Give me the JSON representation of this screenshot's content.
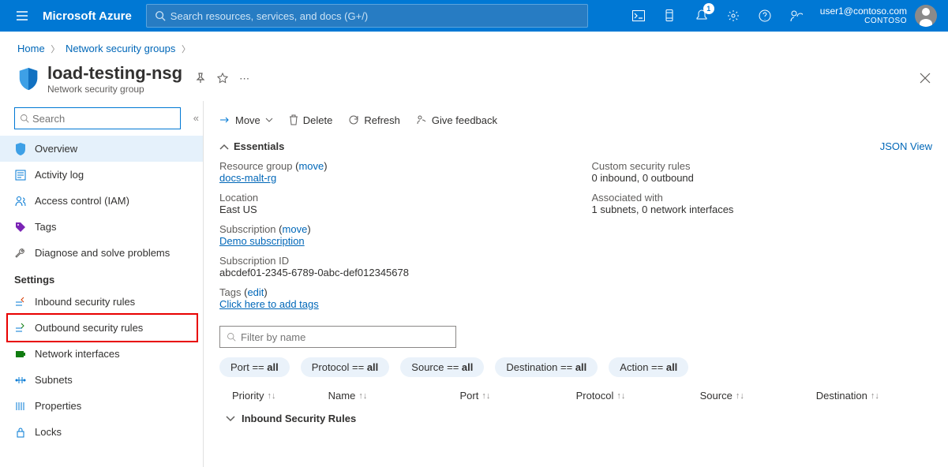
{
  "topbar": {
    "brand": "Microsoft Azure",
    "search_placeholder": "Search resources, services, and docs (G+/)",
    "notification_count": "1",
    "account_email": "user1@contoso.com",
    "account_org": "CONTOSO"
  },
  "breadcrumb": {
    "items": [
      "Home",
      "Network security groups"
    ]
  },
  "header": {
    "title": "load-testing-nsg",
    "subtitle": "Network security group"
  },
  "sidebar": {
    "search_placeholder": "Search",
    "items": [
      {
        "label": "Overview"
      },
      {
        "label": "Activity log"
      },
      {
        "label": "Access control (IAM)"
      },
      {
        "label": "Tags"
      },
      {
        "label": "Diagnose and solve problems"
      }
    ],
    "section_label": "Settings",
    "settings_items": [
      {
        "label": "Inbound security rules"
      },
      {
        "label": "Outbound security rules"
      },
      {
        "label": "Network interfaces"
      },
      {
        "label": "Subnets"
      },
      {
        "label": "Properties"
      },
      {
        "label": "Locks"
      }
    ]
  },
  "commands": {
    "move": "Move",
    "delete": "Delete",
    "refresh": "Refresh",
    "feedback": "Give feedback"
  },
  "essentials": {
    "label": "Essentials",
    "json_view": "JSON View",
    "resource_group_label": "Resource group",
    "resource_group_move": "move",
    "resource_group_value": "docs-malt-rg",
    "location_label": "Location",
    "location_value": "East US",
    "subscription_label": "Subscription",
    "subscription_move": "move",
    "subscription_value": "Demo subscription",
    "subscription_id_label": "Subscription ID",
    "subscription_id_value": "abcdef01-2345-6789-0abc-def012345678",
    "tags_label": "Tags",
    "tags_edit": "edit",
    "tags_value": "Click here to add tags",
    "custom_rules_label": "Custom security rules",
    "custom_rules_value": "0 inbound, 0 outbound",
    "associated_label": "Associated with",
    "associated_value": "1 subnets, 0 network interfaces"
  },
  "filter": {
    "placeholder": "Filter by name"
  },
  "pills": {
    "port_pre": "Port == ",
    "port_val": "all",
    "protocol_pre": "Protocol == ",
    "protocol_val": "all",
    "source_pre": "Source == ",
    "source_val": "all",
    "dest_pre": "Destination == ",
    "dest_val": "all",
    "action_pre": "Action == ",
    "action_val": "all"
  },
  "columns": {
    "priority": "Priority",
    "name": "Name",
    "port": "Port",
    "protocol": "Protocol",
    "source": "Source",
    "destination": "Destination"
  },
  "rules_section": "Inbound Security Rules"
}
